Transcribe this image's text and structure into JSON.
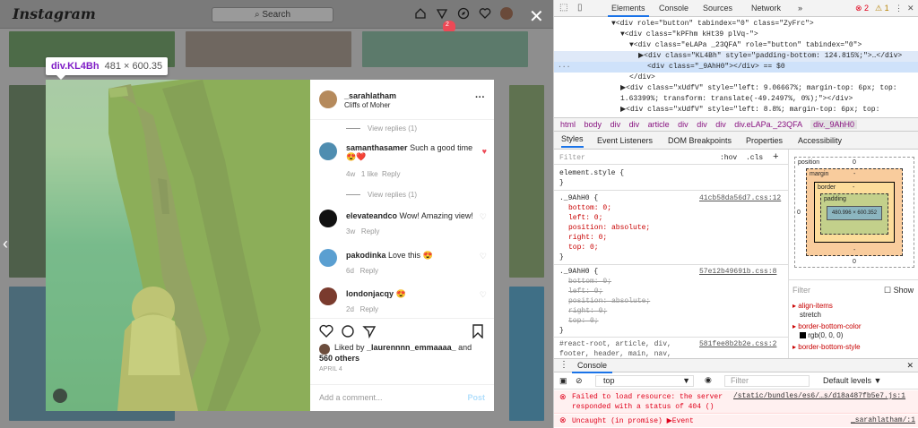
{
  "instagram": {
    "logo": "Instagram",
    "search_placeholder": "Search",
    "notification_count": "2",
    "tooltip": {
      "selector": "div.KL4Bh",
      "size": "481 × 600.35"
    },
    "post": {
      "author": "_sarahlatham",
      "location": "Cliffs of Moher",
      "comments": [
        {
          "type": "replies",
          "text": "View replies (1)"
        },
        {
          "user": "samanthasamer",
          "text": "Such a good time 😍❤️",
          "age": "4w",
          "likes": "1 like",
          "reply": "Reply",
          "liked": true
        },
        {
          "type": "replies",
          "text": "View replies (1)"
        },
        {
          "user": "elevateandco",
          "text": "Wow! Amazing view!",
          "age": "3w",
          "reply": "Reply"
        },
        {
          "user": "pakodinka",
          "text": "Love this 😍",
          "age": "6d",
          "reply": "Reply"
        },
        {
          "user": "londonjacqy",
          "text": "😍",
          "age": "2d",
          "reply": "Reply"
        }
      ],
      "liked_by_prefix": "Liked by",
      "liked_by_user": "_laurennnn_emmaaaa_",
      "liked_by_and": "and",
      "others": "560 others",
      "date": "APRIL 4",
      "add_comment_placeholder": "Add a comment...",
      "post_button": "Post"
    }
  },
  "devtools": {
    "tabs": [
      "Elements",
      "Console",
      "Sources",
      "Network"
    ],
    "more_tabs": "»",
    "error_count": "2",
    "warning_count": "1",
    "dom_lines": [
      {
        "indent": 0,
        "text": "▼<div role=\"button\" tabindex=\"0\" class=\"ZyFrc\">"
      },
      {
        "indent": 1,
        "text": "▼<div class=\"kPFhm kHt39  plVq-\">"
      },
      {
        "indent": 2,
        "text": "▼<div class=\"eLAPa _23QFA\" role=\"button\" tabindex=\"0\">"
      },
      {
        "indent": 3,
        "text": "▶<div class=\"KL4Bh\" style=\"padding-bottom: 124.815%;\">…</div>"
      },
      {
        "indent": 3,
        "text": "<div class=\"_9AhH0\"></div> == $0",
        "selected": true
      },
      {
        "indent": 2,
        "text": "</div>"
      },
      {
        "indent": 1,
        "text": "▶<div class=\"xUdfV\" style=\"left: 9.06667%; margin-top: 6px; top:"
      },
      {
        "indent": 1,
        "text": "1.63399%; transform: translate(-49.2497%, 0%);\"></div>"
      },
      {
        "indent": 1,
        "text": "▶<div class=\"xUdfV\" style=\"left: 8.8%; margin-top: 6px; top:"
      }
    ],
    "breadcrumbs": [
      "html",
      "body",
      "div",
      "div",
      "article",
      "div",
      "div",
      "div",
      "div.eLAPa._23QFA",
      "div._9AhH0"
    ],
    "sub_tabs": [
      "Styles",
      "Event Listeners",
      "DOM Breakpoints",
      "Properties",
      "Accessibility"
    ],
    "filter_placeholder": "Filter",
    "hov": ":hov",
    "cls": ".cls",
    "add_rule": "+",
    "rules": [
      {
        "selector": "element.style {",
        "source": "",
        "props": []
      },
      {
        "selector": "._9AhH0 {",
        "source": "41cb58da56d7.css:12",
        "props": [
          "bottom: 0;",
          "left: 0;",
          "position: absolute;",
          "right: 0;",
          "top: 0;"
        ],
        "struck": false
      },
      {
        "selector": "._9AhH0 {",
        "source": "57e12b49691b.css:8",
        "props": [
          "bottom: 0;",
          "left: 0;",
          "position: absolute;",
          "right: 0;",
          "top: 0;"
        ],
        "struck": true
      },
      {
        "selector": "#react-root, article, div,",
        "source": "581fee8b2b2e.css:2",
        "props": [
          "footer, header, main, nav,"
        ]
      }
    ],
    "box_model": {
      "position_label": "position",
      "margin_label": "margin",
      "border_label": "border",
      "padding_label": "padding",
      "content": "480.996 × 600.352",
      "zero": "0",
      "dash": "-"
    },
    "computed_filter": "Filter",
    "show_all": "Show",
    "computed": [
      {
        "prop": "align-items",
        "value": "stretch"
      },
      {
        "prop": "border-bottom-color",
        "value": "rgb(0, 0, 0)"
      },
      {
        "prop": "border-bottom-style",
        "value": ""
      }
    ],
    "console": {
      "tab": "Console",
      "context": "top",
      "filter": "Filter",
      "levels": "Default levels ▼",
      "errors": [
        {
          "text": "Failed to load resource: the server responded with a status of 404 ()",
          "source": "/static/bundles/es6/…s/d18a487fb5e7.js:1"
        },
        {
          "text": "Uncaught (in promise) ▶Event",
          "source": "_sarahlatham/:1"
        }
      ]
    }
  }
}
